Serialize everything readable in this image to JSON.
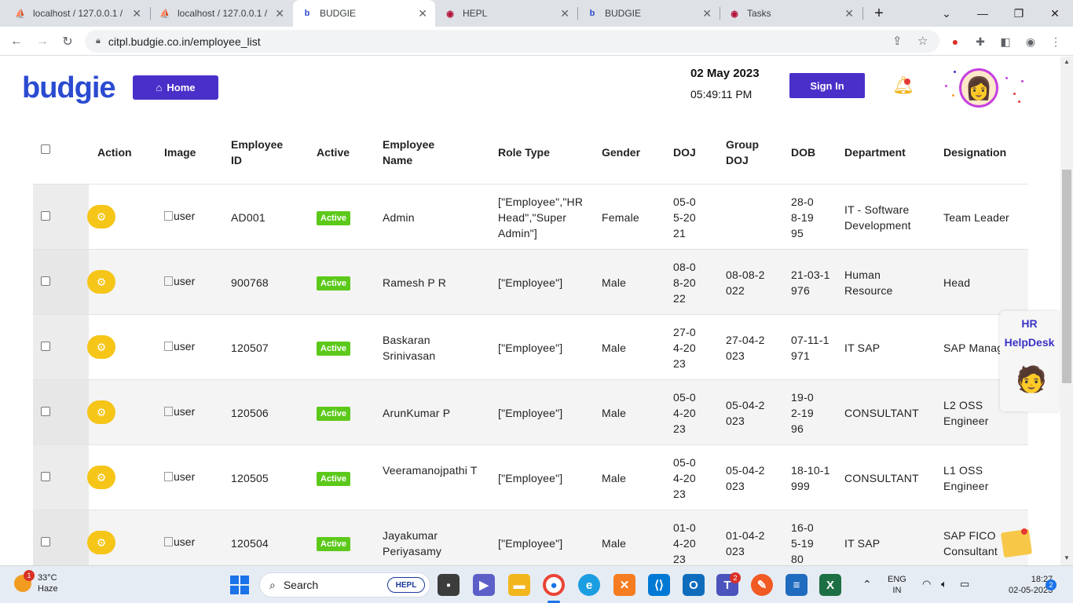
{
  "browser": {
    "tabs": [
      {
        "title": "localhost / 127.0.0.1 /",
        "icon": "phpmyadmin-icon",
        "active": false
      },
      {
        "title": "localhost / 127.0.0.1 /",
        "icon": "phpmyadmin-icon",
        "active": false
      },
      {
        "title": "BUDGIE",
        "icon": "budgie-icon",
        "active": true
      },
      {
        "title": "HEPL",
        "icon": "hepl-icon",
        "active": false
      },
      {
        "title": "BUDGIE",
        "icon": "budgie-icon",
        "active": false
      },
      {
        "title": "Tasks",
        "icon": "hepl-icon",
        "active": false
      }
    ],
    "url": "citpl.budgie.co.in/employee_list"
  },
  "header": {
    "logo_text": "budgie",
    "home_label": "Home",
    "date": "02 May 2023",
    "time": "05:49:11 PM",
    "signin_label": "Sign In",
    "bell_count": "1"
  },
  "table": {
    "columns": [
      "Action",
      "Image",
      "Employee ID",
      "Active",
      "Employee Name",
      "Role Type",
      "Gender",
      "DOJ",
      "Group DOJ",
      "DOB",
      "Department",
      "Designation"
    ],
    "rows": [
      {
        "img": "user",
        "id": "AD001",
        "active": "Active",
        "name": "Admin",
        "role": "[\"Employee\",\"HR Head\",\"Super Admin\"]",
        "gender": "Female",
        "doj": "05-05-2021",
        "gdoj": "",
        "dob": "28-08-1995",
        "dept": "IT - Software Development",
        "desig": "Team Leader"
      },
      {
        "img": "user",
        "id": "900768",
        "active": "Active",
        "name": "Ramesh P R",
        "role": "[\"Employee\"]",
        "gender": "Male",
        "doj": "08-08-2022",
        "gdoj": "08-08-2022",
        "dob": "21-03-1976",
        "dept": "Human Resource",
        "desig": "Head"
      },
      {
        "img": "user",
        "id": "120507",
        "active": "Active",
        "name": "Baskaran Srinivasan",
        "role": "[\"Employee\"]",
        "gender": "Male",
        "doj": "27-04-2023",
        "gdoj": "27-04-2023",
        "dob": "07-11-1971",
        "dept": "IT SAP",
        "desig": "SAP Manag"
      },
      {
        "img": "user",
        "id": "120506",
        "active": "Active",
        "name": "ArunKumar P",
        "role": "[\"Employee\"]",
        "gender": "Male",
        "doj": "05-04-2023",
        "gdoj": "05-04-2023",
        "dob": "19-02-1996",
        "dept": "CONSULTANT",
        "desig": "L2 OSS Engineer"
      },
      {
        "img": "user",
        "id": "120505",
        "active": "Active",
        "name": "Veeramanojpathi T",
        "role": "[\"Employee\"]",
        "gender": "Male",
        "doj": "05-04-2023",
        "gdoj": "05-04-2023",
        "dob": "18-10-1999",
        "dept": "CONSULTANT",
        "desig": "L1 OSS Engineer"
      },
      {
        "img": "user",
        "id": "120504",
        "active": "Active",
        "name": "Jayakumar Periyasamy",
        "role": "[\"Employee\"]",
        "gender": "Male",
        "doj": "01-04-2023",
        "gdoj": "01-04-2023",
        "dob": "16-05-1980",
        "dept": "IT SAP",
        "desig": "SAP FICO Consultant"
      }
    ]
  },
  "helpdesk": {
    "line1": "HR",
    "line2": "HelpDesk"
  },
  "taskbar": {
    "temp": "33°C",
    "weather": "Haze",
    "weather_badge": "1",
    "search_label": "Search",
    "search_brand": "HEPL",
    "lang1": "ENG",
    "lang2": "IN",
    "clock": "18:27",
    "date": "02-05-2023",
    "notif_count": "2",
    "teams_badge": "2"
  },
  "colors": {
    "primary": "#4b2fc9",
    "active_badge": "#5cc91a",
    "action": "#f5c518"
  }
}
